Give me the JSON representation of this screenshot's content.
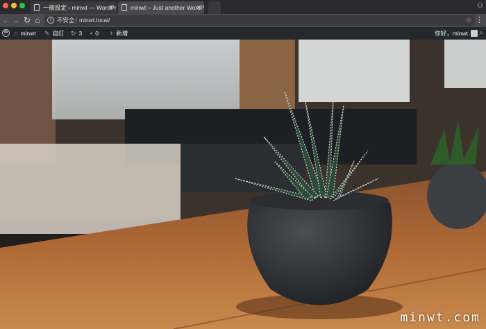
{
  "browser": {
    "tabs": [
      {
        "title": "一般設定 ‹ minwt — WordPress",
        "active": false
      },
      {
        "title": "minwt – Just another WordPress",
        "active": true
      }
    ],
    "security_label": "不安全",
    "url": "minwt.local/"
  },
  "admin_bar": {
    "site_name": "minwt",
    "customize_label": "自訂",
    "updates_count": "3",
    "comments_count": "0",
    "new_label": "新增",
    "greeting": "你好，minwt"
  },
  "hero": {
    "watermark": "minwt.com"
  },
  "colors": {
    "admin_bar_bg": "#23282d",
    "tab_active": "#4a4a4d",
    "table_wood": "#b06a35"
  }
}
